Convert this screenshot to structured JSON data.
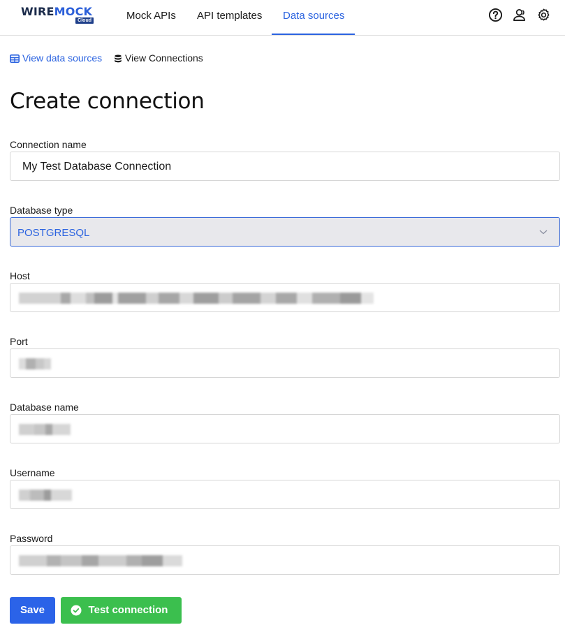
{
  "brand": {
    "logo_main": "WIRE",
    "logo_accent": "MOCK",
    "logo_badge": "Cloud"
  },
  "nav": {
    "items": [
      {
        "label": "Mock APIs"
      },
      {
        "label": "API templates"
      },
      {
        "label": "Data sources",
        "active": true
      }
    ],
    "icons": [
      "help-icon",
      "users-icon",
      "settings-gear-icon"
    ]
  },
  "sublinks": {
    "view_data_sources": "View data sources",
    "view_connections": "View Connections"
  },
  "page": {
    "title": "Create connection"
  },
  "form": {
    "connection_name": {
      "label": "Connection name",
      "value": "My Test Database Connection"
    },
    "database_type": {
      "label": "Database type",
      "value": "POSTGRESQL"
    },
    "host": {
      "label": "Host",
      "value": ""
    },
    "port": {
      "label": "Port",
      "value": ""
    },
    "database_name": {
      "label": "Database name",
      "value": ""
    },
    "username": {
      "label": "Username",
      "value": ""
    },
    "password": {
      "label": "Password",
      "value": ""
    }
  },
  "actions": {
    "save": "Save",
    "test_connection": "Test connection"
  },
  "colors": {
    "accent": "#2b63e0",
    "save_button": "#2b63e8",
    "test_button": "#3bbf4e"
  }
}
